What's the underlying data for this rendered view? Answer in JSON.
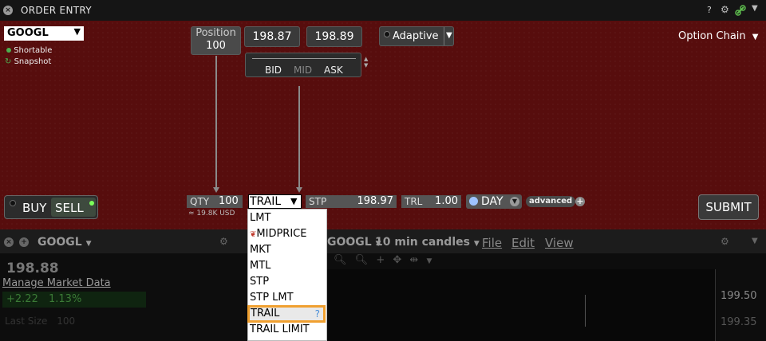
{
  "titlebar": {
    "title": "ORDER ENTRY",
    "help": "?"
  },
  "symbol": {
    "value": "GOOGL",
    "shortable": "Shortable",
    "snapshot": "Snapshot"
  },
  "position": {
    "label": "Position",
    "value": "100"
  },
  "quotes": {
    "bid_price": "198.87",
    "ask_price": "198.89",
    "bid": "BID",
    "mid": "MID",
    "ask": "ASK"
  },
  "algo": {
    "value": "Adaptive"
  },
  "option_chain": "Option Chain",
  "order_row": {
    "buy": "BUY",
    "sell": "SELL",
    "qty_label": "QTY",
    "qty": "100",
    "qty_usd": "≈ 19.8K USD",
    "order_type": "TRAIL",
    "stp_label": "STP",
    "stp": "198.97",
    "trl_label": "TRL",
    "trl": "1.00",
    "tif": "DAY",
    "advanced": "advanced",
    "submit": "SUBMIT"
  },
  "dropdown": {
    "options": [
      "LMT",
      "MIDPRICE",
      "MKT",
      "MTL",
      "STP",
      "STP LMT",
      "TRAIL",
      "TRAIL LIMIT"
    ],
    "selected": "TRAIL",
    "help": "?"
  },
  "lower_left": {
    "symbol": "GOOGL",
    "price": "198.88",
    "manage": "Manage Market Data",
    "change": "+2.22",
    "change_pct": "1.13%",
    "last_size_label": "Last Size",
    "last_size": "100"
  },
  "chart_window": {
    "symbol": "GOOGL",
    "interval": "10 min candles",
    "menu": [
      "File",
      "Edit",
      "View"
    ],
    "price_1": "199.50",
    "price_2": "199.35"
  },
  "colors": {
    "panel": "#570d0d",
    "accent": "#f0a030",
    "green": "#4caf50"
  }
}
